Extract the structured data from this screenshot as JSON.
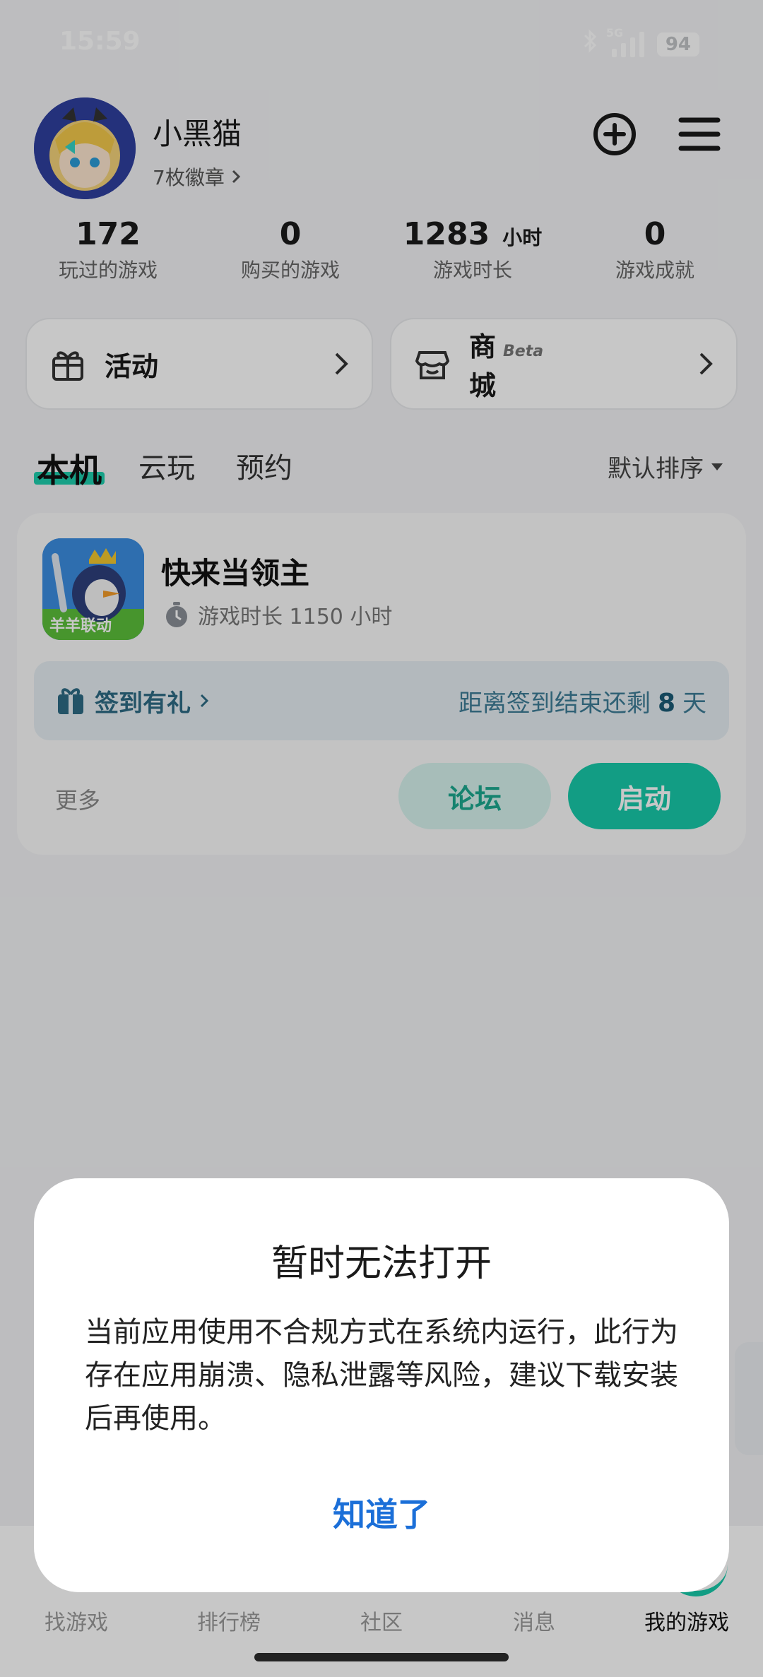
{
  "status_bar": {
    "time": "15:59",
    "network": "5G",
    "battery": "94"
  },
  "profile": {
    "username": "小黑猫",
    "badges": "7枚徽章"
  },
  "stats": [
    {
      "value": "172",
      "unit": "",
      "label": "玩过的游戏"
    },
    {
      "value": "0",
      "unit": "",
      "label": "购买的游戏"
    },
    {
      "value": "1283",
      "unit": "小时",
      "label": "游戏时长"
    },
    {
      "value": "0",
      "unit": "",
      "label": "游戏成就"
    }
  ],
  "cards": {
    "activity": "活动",
    "store": "商城",
    "store_tag": "Beta"
  },
  "tabs": {
    "local": "本机",
    "cloud": "云玩",
    "reserve": "预约",
    "sort": "默认排序"
  },
  "game": {
    "name": "快来当领主",
    "playtime": "游戏时长 1150 小时",
    "icon_caption": "羊羊联动",
    "checkin_label": "签到有礼",
    "checkin_prefix": "距离签到结束还剩",
    "checkin_days": "8",
    "checkin_suffix": "天",
    "more": "更多",
    "forum_button": "论坛",
    "launch_button": "启动"
  },
  "bottom_nav": [
    "找游戏",
    "排行榜",
    "社区",
    "消息",
    "我的游戏"
  ],
  "dialog": {
    "title": "暂时无法打开",
    "message": "当前应用使用不合规方式在系统内运行，此行为存在应用崩溃、隐私泄露等风险，建议下载安装后再使用。",
    "confirm": "知道了"
  },
  "colors": {
    "accent": "#18c9aa",
    "link": "#1b6fd8"
  }
}
